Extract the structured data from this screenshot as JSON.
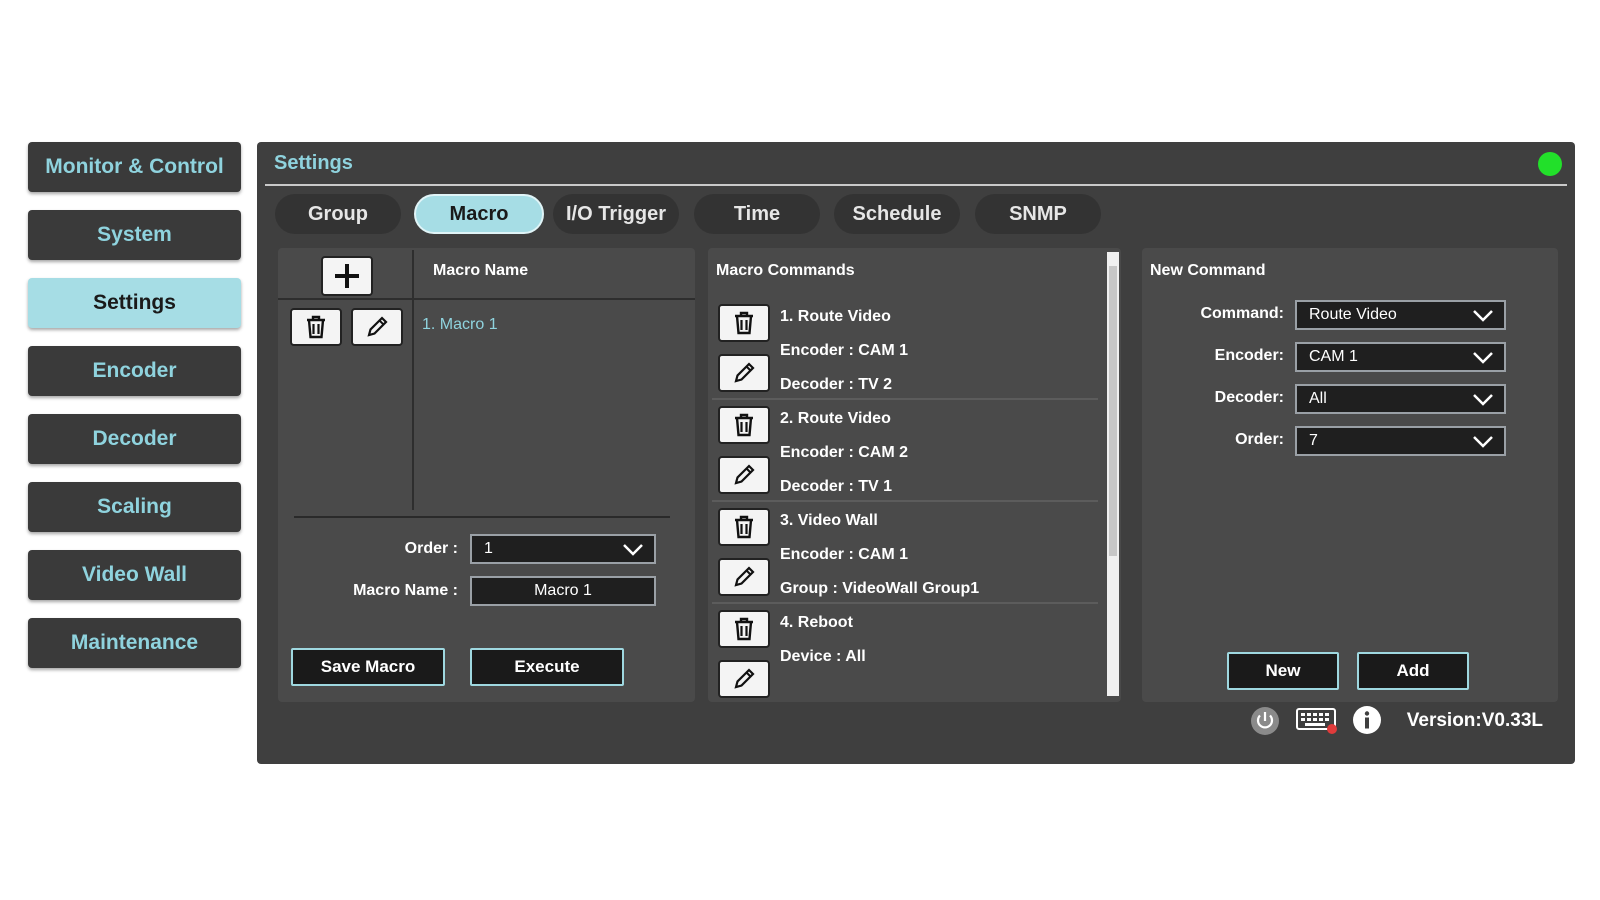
{
  "sidebar": {
    "items": [
      {
        "label": "Monitor & Control"
      },
      {
        "label": "System"
      },
      {
        "label": "Settings"
      },
      {
        "label": "Encoder"
      },
      {
        "label": "Decoder"
      },
      {
        "label": "Scaling"
      },
      {
        "label": "Video Wall"
      },
      {
        "label": "Maintenance"
      }
    ],
    "active": "Settings"
  },
  "panel": {
    "title": "Settings",
    "status_color": "#22e02a"
  },
  "tabs": [
    {
      "label": "Group"
    },
    {
      "label": "Macro"
    },
    {
      "label": "I/O Trigger"
    },
    {
      "label": "Time"
    },
    {
      "label": "Schedule"
    },
    {
      "label": "SNMP"
    }
  ],
  "active_tab": "Macro",
  "macro_list": {
    "header": "Macro Name",
    "items": [
      "1. Macro 1"
    ],
    "order_label": "Order :",
    "order_value": "1",
    "name_label": "Macro Name :",
    "name_value": "Macro 1",
    "save_label": "Save Macro",
    "execute_label": "Execute"
  },
  "macro_commands": {
    "header": "Macro Commands",
    "items": [
      {
        "title": "1. Route Video",
        "line2": "Encoder : CAM 1",
        "line3": "Decoder : TV 2"
      },
      {
        "title": "2. Route Video",
        "line2": "Encoder : CAM 2",
        "line3": "Decoder : TV 1"
      },
      {
        "title": "3. Video Wall",
        "line2": "Encoder : CAM 1",
        "line3": "Group : VideoWall Group1"
      },
      {
        "title": "4. Reboot",
        "line2": "Device : All",
        "line3": ""
      }
    ]
  },
  "new_command": {
    "header": "New Command",
    "command_label": "Command:",
    "command_value": "Route Video",
    "encoder_label": "Encoder:",
    "encoder_value": "CAM 1",
    "decoder_label": "Decoder:",
    "decoder_value": "All",
    "order_label": "Order:",
    "order_value": "7",
    "new_label": "New",
    "add_label": "Add"
  },
  "footer": {
    "version": "Version:V0.33L",
    "icons": [
      "power-icon",
      "keyboard-icon",
      "info-icon"
    ]
  },
  "colors": {
    "accent": "#8fd3de",
    "active_bg": "#a6dde5",
    "panel_bg": "#3f3f3f"
  }
}
